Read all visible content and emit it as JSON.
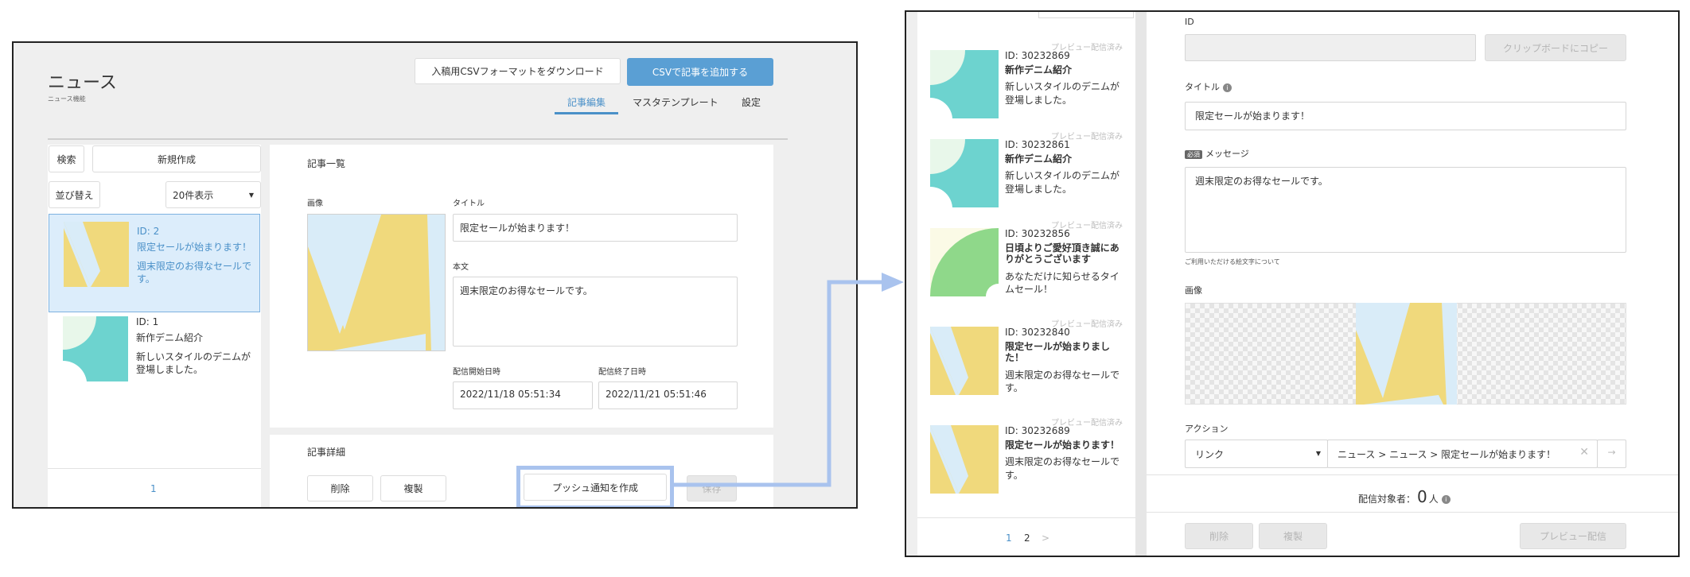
{
  "left": {
    "page_title": "ニュース",
    "page_subtitle": "ニュース機能",
    "download_button": "入稿用CSVフォーマットをダウンロード",
    "add_csv_button": "CSVで記事を追加する",
    "tabs": [
      "記事編集",
      "マスタテンプレート",
      "設定"
    ],
    "search_button": "検索",
    "new_button": "新規作成",
    "sort_button": "並び替え",
    "per_page_select": "20件表示",
    "articles": [
      {
        "id": "ID: 2",
        "title": "限定セールが始まります！",
        "body": "週末限定のお得なセールです。"
      },
      {
        "id": "ID: 1",
        "title": "新作デニム紹介",
        "body": "新しいスタイルのデニムが登場しました。"
      }
    ],
    "pagination": "1",
    "list_panel_title": "記事一覧",
    "image_label": "画像",
    "title_label": "タイトル",
    "title_value": "限定セールが始まります！",
    "body_label": "本文",
    "body_value": "週末限定のお得なセールです。",
    "start_label": "配信開始日時",
    "start_value": "2022/11/18 05:51:34",
    "end_label": "配信終了日時",
    "end_value": "2022/11/21 05:51:46",
    "detail_panel_title": "記事詳細",
    "delete_button": "削除",
    "copy_button": "複製",
    "push_button": "プッシュ通知を作成",
    "save_button": "保存"
  },
  "right": {
    "top_partial": "",
    "items": [
      {
        "status": "プレビュー配信済み",
        "id": "ID: 30232869",
        "title": "新作デニム紹介",
        "body": "新しいスタイルのデニムが登場しました。",
        "thumb": "denim"
      },
      {
        "status": "プレビュー配信済み",
        "id": "ID: 30232861",
        "title": "新作デニム紹介",
        "body": "新しいスタイルのデニムが登場しました。",
        "thumb": "denim"
      },
      {
        "status": "プレビュー配信済み",
        "id": "ID: 30232856",
        "title": "日頃よりご愛好頂き誠にありがとうございます",
        "body": "あなただけに知らせるタイムセール！",
        "thumb": "green"
      },
      {
        "status": "プレビュー配信済み",
        "id": "ID: 30232840",
        "title": "限定セールが始まりました！",
        "body": "週末限定のお得なセールです。",
        "thumb": "sale"
      },
      {
        "status": "プレビュー配信済み",
        "id": "ID: 30232689",
        "title": "限定セールが始まります！",
        "body": "週末限定のお得なセールです。",
        "thumb": "sale"
      }
    ],
    "pagination": [
      "1",
      "2",
      ">"
    ],
    "id_label": "ID",
    "id_value": "",
    "copy_clipboard_button": "クリップボードにコピー",
    "title_label": "タイトル",
    "title_value": "限定セールが始まります！",
    "required_badge": "必須",
    "message_label": "メッセージ",
    "message_value": "週末限定のお得なセールです。",
    "usable_chars_note": "ご利用いただける絵文字について",
    "image_label": "画像",
    "action_label": "アクション",
    "action_select": "リンク",
    "action_value": "ニュース > ニュース > 限定セールが始まります！",
    "target_label": "配信対象者：",
    "target_count": "0",
    "target_unit": "人",
    "delete_button": "削除",
    "copy_button": "複製",
    "preview_button": "プレビュー配信"
  },
  "colors": {
    "accent_blue": "#5a9fd4",
    "highlight_border": "#a9c3ee",
    "thumb_yellow": "#f0d97c",
    "thumb_lightblue": "#d9ecf8",
    "thumb_teal": "#6dd3cf",
    "thumb_green": "#8fd88a"
  }
}
